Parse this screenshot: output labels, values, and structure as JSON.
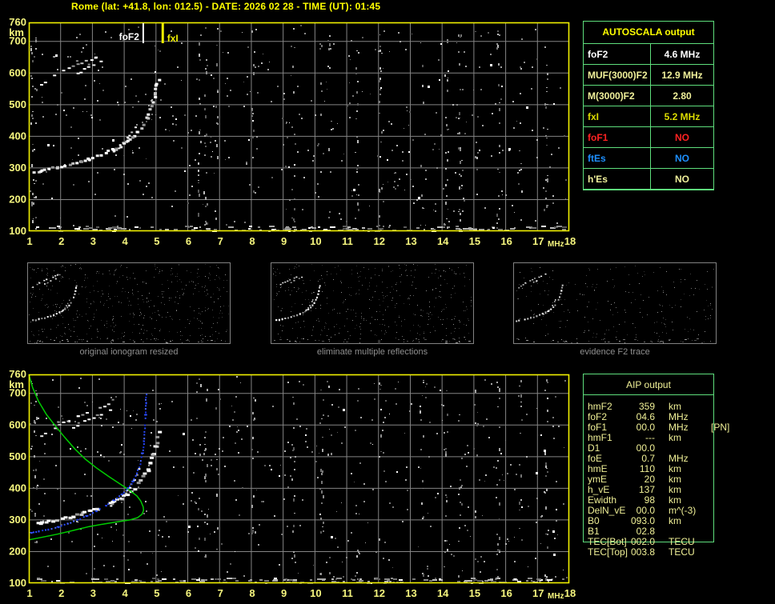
{
  "title": "Rome (lat: +41.8, lon: 012.5) - DATE: 2026 02 28 - TIME (UT): 01:45",
  "autoscala": {
    "header": "AUTOSCALA output",
    "rows": [
      {
        "label": "foF2",
        "value": "4.6 MHz",
        "color": "#ffffff"
      },
      {
        "label": "MUF(3000)F2",
        "value": "12.9 MHz",
        "color": "#f0f09a"
      },
      {
        "label": "M(3000)F2",
        "value": "2.80",
        "color": "#f0f09a"
      },
      {
        "label": "fxI",
        "value": "5.2 MHz",
        "color": "#dcdc00"
      },
      {
        "label": "foF1",
        "value": "NO",
        "color": "#ff2222"
      },
      {
        "label": "ftEs",
        "value": "NO",
        "color": "#1e90ff"
      },
      {
        "label": "h'Es",
        "value": "NO",
        "color": "#f0f09a"
      }
    ]
  },
  "aip": {
    "header": "AIP output",
    "rows": [
      {
        "label": "hmF2",
        "value": "359",
        "unit": "km",
        "extra": ""
      },
      {
        "label": "foF2",
        "value": "04.6",
        "unit": "MHz",
        "extra": ""
      },
      {
        "label": "foF1",
        "value": "00.0",
        "unit": "MHz",
        "extra": "[PN]"
      },
      {
        "label": "hmF1",
        "value": "---",
        "unit": "km",
        "extra": ""
      },
      {
        "label": "D1",
        "value": "00.0",
        "unit": "",
        "extra": ""
      },
      {
        "label": "foE",
        "value": "0.7",
        "unit": "MHz",
        "extra": ""
      },
      {
        "label": "hmE",
        "value": "110",
        "unit": "km",
        "extra": ""
      },
      {
        "label": "ymE",
        "value": "20",
        "unit": "km",
        "extra": ""
      },
      {
        "label": "h_vE",
        "value": "137",
        "unit": "km",
        "extra": ""
      },
      {
        "label": "Ewidth",
        "value": "98",
        "unit": "km",
        "extra": ""
      },
      {
        "label": "DelN_vE",
        "value": "00.0",
        "unit": "m^(-3)",
        "extra": ""
      },
      {
        "label": "B0",
        "value": "093.0",
        "unit": "km",
        "extra": ""
      },
      {
        "label": "B1",
        "value": "02.8",
        "unit": "",
        "extra": ""
      },
      {
        "label": "TEC[Bot]",
        "value": "002.0",
        "unit": "TECU",
        "extra": ""
      },
      {
        "label": "TEC[Top]",
        "value": "003.8",
        "unit": "TECU",
        "extra": ""
      }
    ]
  },
  "thumbnails": [
    {
      "label": "original ionogram resized"
    },
    {
      "label": "eliminate multiple reflections"
    },
    {
      "label": "evidence F2 trace"
    }
  ],
  "chart_data": {
    "type": "scatter",
    "x_ticks": [
      1,
      2,
      3,
      4,
      5,
      6,
      7,
      8,
      9,
      10,
      11,
      12,
      13,
      14,
      15,
      16,
      17,
      18
    ],
    "x_unit": "MHz",
    "y_ticks": [
      760,
      700,
      600,
      500,
      400,
      300,
      200,
      100
    ],
    "y_unit": "km",
    "xlim": [
      1,
      18
    ],
    "ylim": [
      100,
      760
    ],
    "grid": true,
    "markers": [
      {
        "label": "foF2",
        "freq": 4.6,
        "color": "#ffffff"
      },
      {
        "label": "fxI",
        "freq": 5.2,
        "color": "#f0f000"
      }
    ],
    "traces": {
      "f2_trace": [
        [
          1.15,
          291
        ],
        [
          1.35,
          295
        ],
        [
          1.6,
          299
        ],
        [
          1.85,
          304
        ],
        [
          2.1,
          310
        ],
        [
          2.35,
          316
        ],
        [
          2.6,
          323
        ],
        [
          2.85,
          330
        ],
        [
          3.1,
          339
        ],
        [
          3.35,
          349
        ],
        [
          3.6,
          360
        ],
        [
          3.85,
          373
        ],
        [
          4.05,
          386
        ],
        [
          4.25,
          402
        ],
        [
          4.4,
          418
        ],
        [
          4.55,
          439
        ],
        [
          4.68,
          462
        ],
        [
          4.78,
          486
        ],
        [
          4.87,
          512
        ],
        [
          4.93,
          538
        ],
        [
          4.98,
          562
        ],
        [
          5.03,
          582
        ]
      ],
      "x_branch": [
        [
          3.45,
          341
        ],
        [
          3.62,
          353
        ],
        [
          3.78,
          366
        ],
        [
          3.93,
          380
        ],
        [
          4.07,
          396
        ],
        [
          4.2,
          413
        ],
        [
          4.3,
          430
        ],
        [
          4.38,
          447
        ],
        [
          4.44,
          461
        ]
      ],
      "second_hop": [
        [
          [
            1.35,
            565
          ],
          [
            1.9,
            602
          ],
          [
            2.5,
            630
          ],
          [
            3.05,
            651
          ],
          [
            3.6,
            673
          ]
        ],
        [
          [
            2.35,
            593
          ],
          [
            2.85,
            620
          ],
          [
            3.5,
            649
          ]
        ]
      ]
    },
    "profile_series": [
      {
        "name": "electron-density-profile",
        "color": "#00cc00",
        "points": [
          [
            1.0,
            760
          ],
          [
            1.12,
            718
          ],
          [
            1.3,
            676
          ],
          [
            1.55,
            634
          ],
          [
            1.82,
            599
          ],
          [
            2.12,
            562
          ],
          [
            2.45,
            524
          ],
          [
            2.78,
            492
          ],
          [
            3.12,
            465
          ],
          [
            3.5,
            438
          ],
          [
            3.88,
            413
          ],
          [
            4.18,
            393
          ],
          [
            4.4,
            376
          ],
          [
            4.52,
            360
          ],
          [
            4.6,
            341
          ],
          [
            4.61,
            330
          ],
          [
            4.56,
            318
          ],
          [
            4.42,
            307
          ],
          [
            4.18,
            300
          ],
          [
            3.85,
            295
          ],
          [
            3.4,
            288
          ],
          [
            2.9,
            279
          ],
          [
            2.4,
            267
          ],
          [
            1.9,
            255
          ],
          [
            1.45,
            246
          ],
          [
            1.0,
            237
          ]
        ]
      },
      {
        "name": "restored-trace",
        "color": "#2a4bff",
        "points": [
          [
            1.05,
            262
          ],
          [
            1.3,
            266
          ],
          [
            1.6,
            272
          ],
          [
            1.9,
            280
          ],
          [
            2.2,
            290
          ],
          [
            2.5,
            302
          ],
          [
            2.8,
            315
          ],
          [
            3.1,
            330
          ],
          [
            3.4,
            347
          ],
          [
            3.65,
            364
          ],
          [
            3.9,
            383
          ],
          [
            4.1,
            403
          ],
          [
            4.25,
            424
          ],
          [
            4.38,
            449
          ],
          [
            4.48,
            479
          ],
          [
            4.55,
            513
          ],
          [
            4.6,
            551
          ],
          [
            4.63,
            592
          ],
          [
            4.65,
            634
          ],
          [
            4.66,
            672
          ],
          [
            4.67,
            700
          ]
        ]
      }
    ]
  }
}
